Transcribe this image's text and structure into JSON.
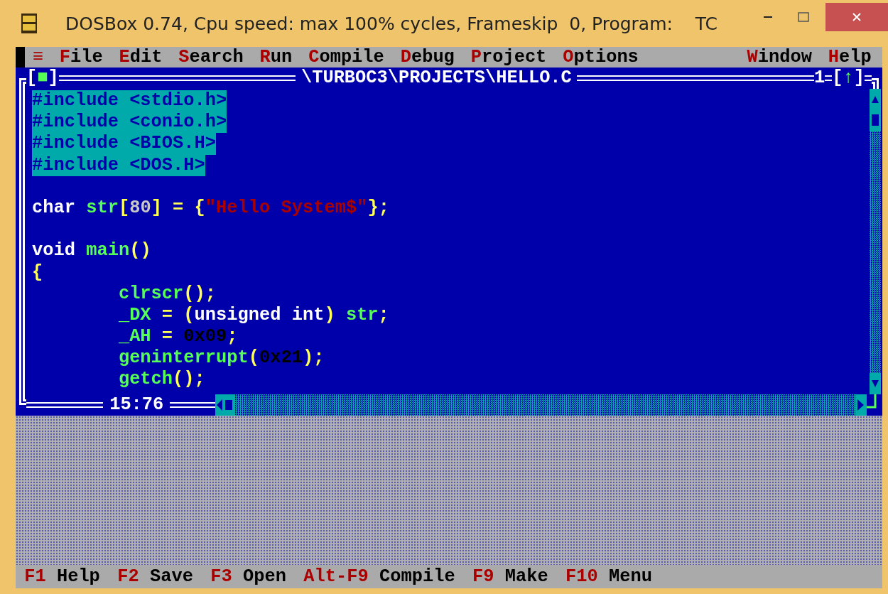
{
  "title_bar": {
    "title": "DOSBox 0.74, Cpu speed: max 100% cycles, Frameskip  0, Program:    TC"
  },
  "menu_bar": {
    "system": "≡",
    "items": [
      {
        "key": "F",
        "rest": "ile"
      },
      {
        "key": "E",
        "rest": "dit"
      },
      {
        "key": "S",
        "rest": "earch"
      },
      {
        "key": "R",
        "rest": "un"
      },
      {
        "key": "C",
        "rest": "ompile"
      },
      {
        "key": "D",
        "rest": "ebug"
      },
      {
        "key": "P",
        "rest": "roject"
      },
      {
        "key": "O",
        "rest": "ptions"
      }
    ],
    "right_items": [
      {
        "key": "W",
        "rest": "indow"
      },
      {
        "key": "H",
        "rest": "elp"
      }
    ]
  },
  "editor": {
    "close_box": "[■]",
    "title": "\\TURBOC3\\PROJECTS\\HELLO.C",
    "window_number": "1",
    "zoom_box": "[↑]",
    "position": "15:76",
    "lines": [
      {
        "selected": true,
        "tokens": [
          {
            "text": "#include <stdio.h>",
            "kind": "keyword"
          }
        ]
      },
      {
        "selected": true,
        "tokens": [
          {
            "text": "#include <conio.h>",
            "kind": "keyword"
          }
        ]
      },
      {
        "selected": true,
        "tokens": [
          {
            "text": "#include <BIOS.H>",
            "kind": "keyword"
          }
        ]
      },
      {
        "selected": true,
        "tokens": [
          {
            "text": "#include <DOS.H>",
            "kind": "keyword"
          }
        ]
      },
      {
        "selected": false
      },
      {
        "selected": false,
        "tokens": [
          {
            "text": "char ",
            "kind": "keyword"
          },
          {
            "text": "str",
            "kind": "identifier"
          },
          {
            "text": "[",
            "kind": "symbol"
          },
          {
            "text": "80",
            "kind": "number"
          },
          {
            "text": "] = {",
            "kind": "symbol"
          },
          {
            "text": "\"Hello System$\"",
            "kind": "string"
          },
          {
            "text": "};",
            "kind": "symbol"
          }
        ]
      },
      {
        "selected": false
      },
      {
        "selected": false,
        "tokens": [
          {
            "text": "void ",
            "kind": "keyword"
          },
          {
            "text": "main",
            "kind": "identifier"
          },
          {
            "text": "()",
            "kind": "symbol"
          }
        ]
      },
      {
        "selected": false,
        "tokens": [
          {
            "text": "{",
            "kind": "symbol"
          }
        ]
      },
      {
        "selected": false,
        "tokens": [
          {
            "text": "        clrscr",
            "kind": "identifier"
          },
          {
            "text": "();",
            "kind": "symbol"
          }
        ]
      },
      {
        "selected": false,
        "tokens": [
          {
            "text": "        _DX",
            "kind": "identifier"
          },
          {
            "text": " = (",
            "kind": "symbol"
          },
          {
            "text": "unsigned int",
            "kind": "keyword"
          },
          {
            "text": ") ",
            "kind": "symbol"
          },
          {
            "text": "str",
            "kind": "identifier"
          },
          {
            "text": ";",
            "kind": "symbol"
          }
        ]
      },
      {
        "selected": false,
        "tokens": [
          {
            "text": "        _AH",
            "kind": "identifier"
          },
          {
            "text": " = ",
            "kind": "symbol"
          },
          {
            "text": "0x09",
            "kind": "hex"
          },
          {
            "text": ";",
            "kind": "symbol"
          }
        ]
      },
      {
        "selected": false,
        "tokens": [
          {
            "text": "        geninterrupt",
            "kind": "identifier"
          },
          {
            "text": "(",
            "kind": "symbol"
          },
          {
            "text": "0x21",
            "kind": "hex"
          },
          {
            "text": ");",
            "kind": "symbol"
          }
        ]
      },
      {
        "selected": false,
        "tokens": [
          {
            "text": "        getch",
            "kind": "identifier"
          },
          {
            "text": "();",
            "kind": "symbol"
          }
        ]
      }
    ]
  },
  "status_bar": [
    {
      "key": "F1",
      "label": "Help"
    },
    {
      "key": "F2",
      "label": "Save"
    },
    {
      "key": "F3",
      "label": "Open"
    },
    {
      "key": "Alt-F9",
      "label": "Compile"
    },
    {
      "key": "F9",
      "label": "Make"
    },
    {
      "key": "F10",
      "label": "Menu"
    }
  ]
}
